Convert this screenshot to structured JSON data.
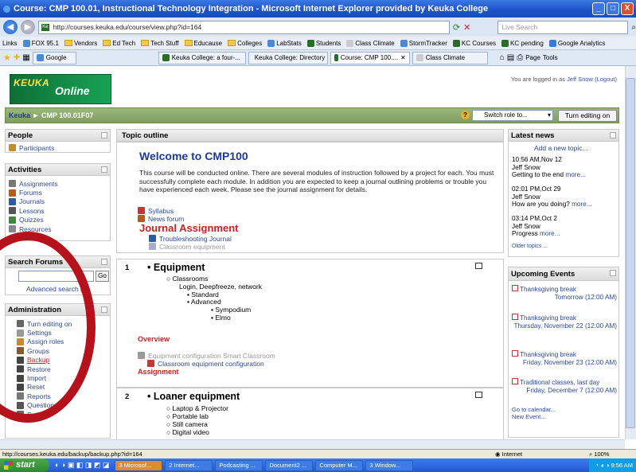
{
  "window": {
    "title": "Course: CMP 100.01, Instructional Technology Integration - Microsoft Internet Explorer provided by Keuka College",
    "min": "_",
    "max": "□",
    "close": "X"
  },
  "address_bar": {
    "url": "http://courses.keuka.edu/course/view.php?id=164",
    "search_placeholder": "Live Search"
  },
  "links_bar": {
    "label": "Links",
    "items": [
      "FOX 95.1",
      "Vendors",
      "Ed Tech",
      "Tech Stuff",
      "Educause",
      "Colleges",
      "LabStats",
      "Students",
      "Class Climate",
      "StormTracker",
      "KC Courses",
      "KC pending",
      "Google Analytics"
    ]
  },
  "tabs": [
    "Google",
    "Keuka College: a four-...",
    "Keuka College: Directory",
    "Course: CMP 100....",
    "Class Climate"
  ],
  "tab_tools": [
    "Page",
    "Tools"
  ],
  "moodle": {
    "logo_brand": "KEUKA",
    "logo_text": "Online",
    "logged_in_prefix": "You are logged in as",
    "logged_in_user": "Jeff Snow",
    "logout": "(Logout)",
    "breadcrumb_home": "Keuka",
    "breadcrumb_sep": "►",
    "breadcrumb_course": "CMP 100.01F07",
    "switch_role": "Switch role to...",
    "turn_editing_on": "Turn editing on"
  },
  "left_blocks": {
    "people": {
      "title": "People",
      "items": [
        "Participants"
      ]
    },
    "activities": {
      "title": "Activities",
      "items": [
        "Assignments",
        "Forums",
        "Journals",
        "Lessons",
        "Quizzes",
        "Resources"
      ]
    },
    "search": {
      "title": "Search Forums",
      "go": "Go",
      "advanced": "Advanced search"
    },
    "administration": {
      "title": "Administration",
      "items": [
        "Turn editing on",
        "Settings",
        "Assign roles",
        "Groups",
        "Backup",
        "Restore",
        "Import",
        "Reset",
        "Reports",
        "Questions",
        "Scales"
      ]
    }
  },
  "center": {
    "header": "Topic outline",
    "welcome": "Welcome to CMP100",
    "intro": "This course will be conducted online. There are several modules of instruction followed by a project for each. You must successfully complete each module. In addition you are expected to keep a journal outlining problems or trouble you have experienced each week. Please see the journal assignment for details.",
    "intro_links": [
      "Syllabus",
      "News forum"
    ],
    "journal_heading": "Journal Assignment",
    "journal_links": [
      "Troubleshooting Journal",
      "Classroom equipment"
    ],
    "topic1": {
      "number": "1",
      "title": "Equipment",
      "l1": "Classrooms",
      "l2": "Login, Deepfreeze, network",
      "l3a": "Standard",
      "l3b": "Advanced",
      "l4a": "Sympodium",
      "l4b": "Elmo",
      "overview": "Overview",
      "res1": "Equipment configuration Smart Classroom",
      "res2": "Classroom equipment configuration",
      "assignment": "Assignment"
    },
    "topic2": {
      "number": "2",
      "title": "Loaner equipment",
      "items": [
        "Laptop & Projector",
        "Portable lab",
        "Still camera",
        "Digital video"
      ]
    }
  },
  "right_blocks": {
    "news": {
      "title": "Latest news",
      "add": "Add a new topic...",
      "posts": [
        {
          "time": "10:56 AM,Nov 12",
          "author": "Jeff Snow",
          "text": "Getting to the end",
          "more": "more..."
        },
        {
          "time": "02:01 PM,Oct 29",
          "author": "Jeff Snow",
          "text": "How are you doing?",
          "more": "more..."
        },
        {
          "time": "03:14 PM,Oct 2",
          "author": "Jeff Snow",
          "text": "Progress",
          "more": "more..."
        }
      ],
      "older": "Older topics ..."
    },
    "events": {
      "title": "Upcoming Events",
      "items": [
        {
          "name": "Thanksgiving break",
          "when": "Tomorrow (12:00 AM)"
        },
        {
          "name": "Thanksgiving break",
          "when": "Thursday, November 22 (12:00 AM)"
        },
        {
          "name": "Thanksgiving break",
          "when": "Friday, November 23 (12:00 AM)"
        },
        {
          "name": "Traditional classes, last day",
          "when": "Friday, December 7 (12:00 AM)"
        }
      ],
      "goto": "Go to calendar...",
      "new": "New Event..."
    }
  },
  "status_bar": {
    "url": "http://courses.keuka.edu/backup/backup.php?id=164",
    "zone": "Internet",
    "zoom": "100%"
  },
  "taskbar": {
    "start": "start",
    "buttons": [
      "3 Microsof...",
      "2 Internet...",
      "Podcasting ...",
      "Document2 ...",
      "Computer M...",
      "3 Window..."
    ],
    "clock": "9:56 AM"
  },
  "colors": {
    "annotation_circle": "#b5121b",
    "link": "#2d4a9b",
    "heading_red": "#cc2222"
  }
}
